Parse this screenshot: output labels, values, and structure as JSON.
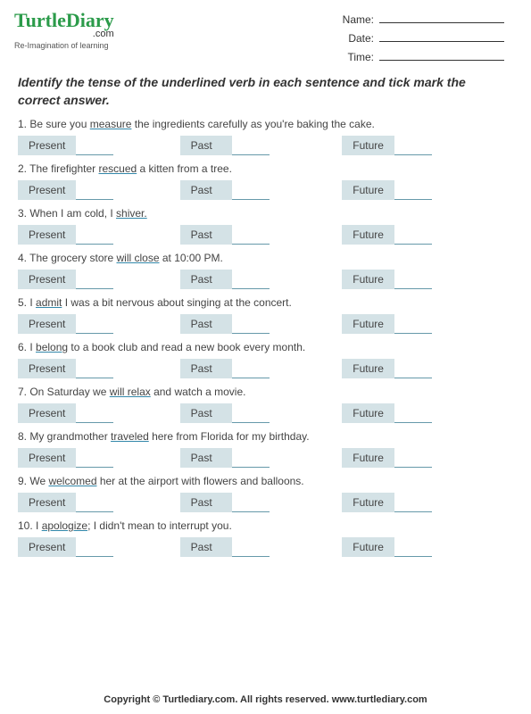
{
  "logo": {
    "main_turtle": "Turtle",
    "main_diary": "Diary",
    "sub": ".com",
    "tagline": "Re-Imagination of learning"
  },
  "fields": {
    "name": "Name:",
    "date": "Date:",
    "time": "Time:"
  },
  "instructions": "Identify the tense of the underlined verb in each sentence and tick mark the correct answer.",
  "option_labels": {
    "present": "Present",
    "past": "Past",
    "future": "Future"
  },
  "questions": [
    {
      "num": "1.",
      "pre": "Be sure you ",
      "u": "measure",
      "post": " the ingredients carefully as you're baking the cake."
    },
    {
      "num": "2.",
      "pre": "The firefighter ",
      "u": "rescued",
      "post": " a kitten from a tree."
    },
    {
      "num": "3.",
      "pre": "When I am cold, I ",
      "u": "shiver.",
      "post": ""
    },
    {
      "num": "4.",
      "pre": "The grocery store ",
      "u": "will close",
      "post": " at 10:00 PM."
    },
    {
      "num": "5.",
      "pre": "I ",
      "u": "admit",
      "post": " I was a bit nervous about singing at the concert."
    },
    {
      "num": "6.",
      "pre": "I ",
      "u": "belong",
      "post": " to a book club and read a new book every month."
    },
    {
      "num": "7.",
      "pre": "On Saturday we ",
      "u": "will relax",
      "post": " and watch a movie."
    },
    {
      "num": "8.",
      "pre": "My grandmother ",
      "u": "traveled",
      "post": " here from Florida for my birthday."
    },
    {
      "num": "9.",
      "pre": "We ",
      "u": "welcomed",
      "post": " her at the airport with flowers and balloons."
    },
    {
      "num": "10.",
      "pre": "I ",
      "u": "apologize",
      "post": "; I didn't mean to interrupt you."
    }
  ],
  "footer": "Copyright © Turtlediary.com. All rights reserved.   www.turtlediary.com"
}
